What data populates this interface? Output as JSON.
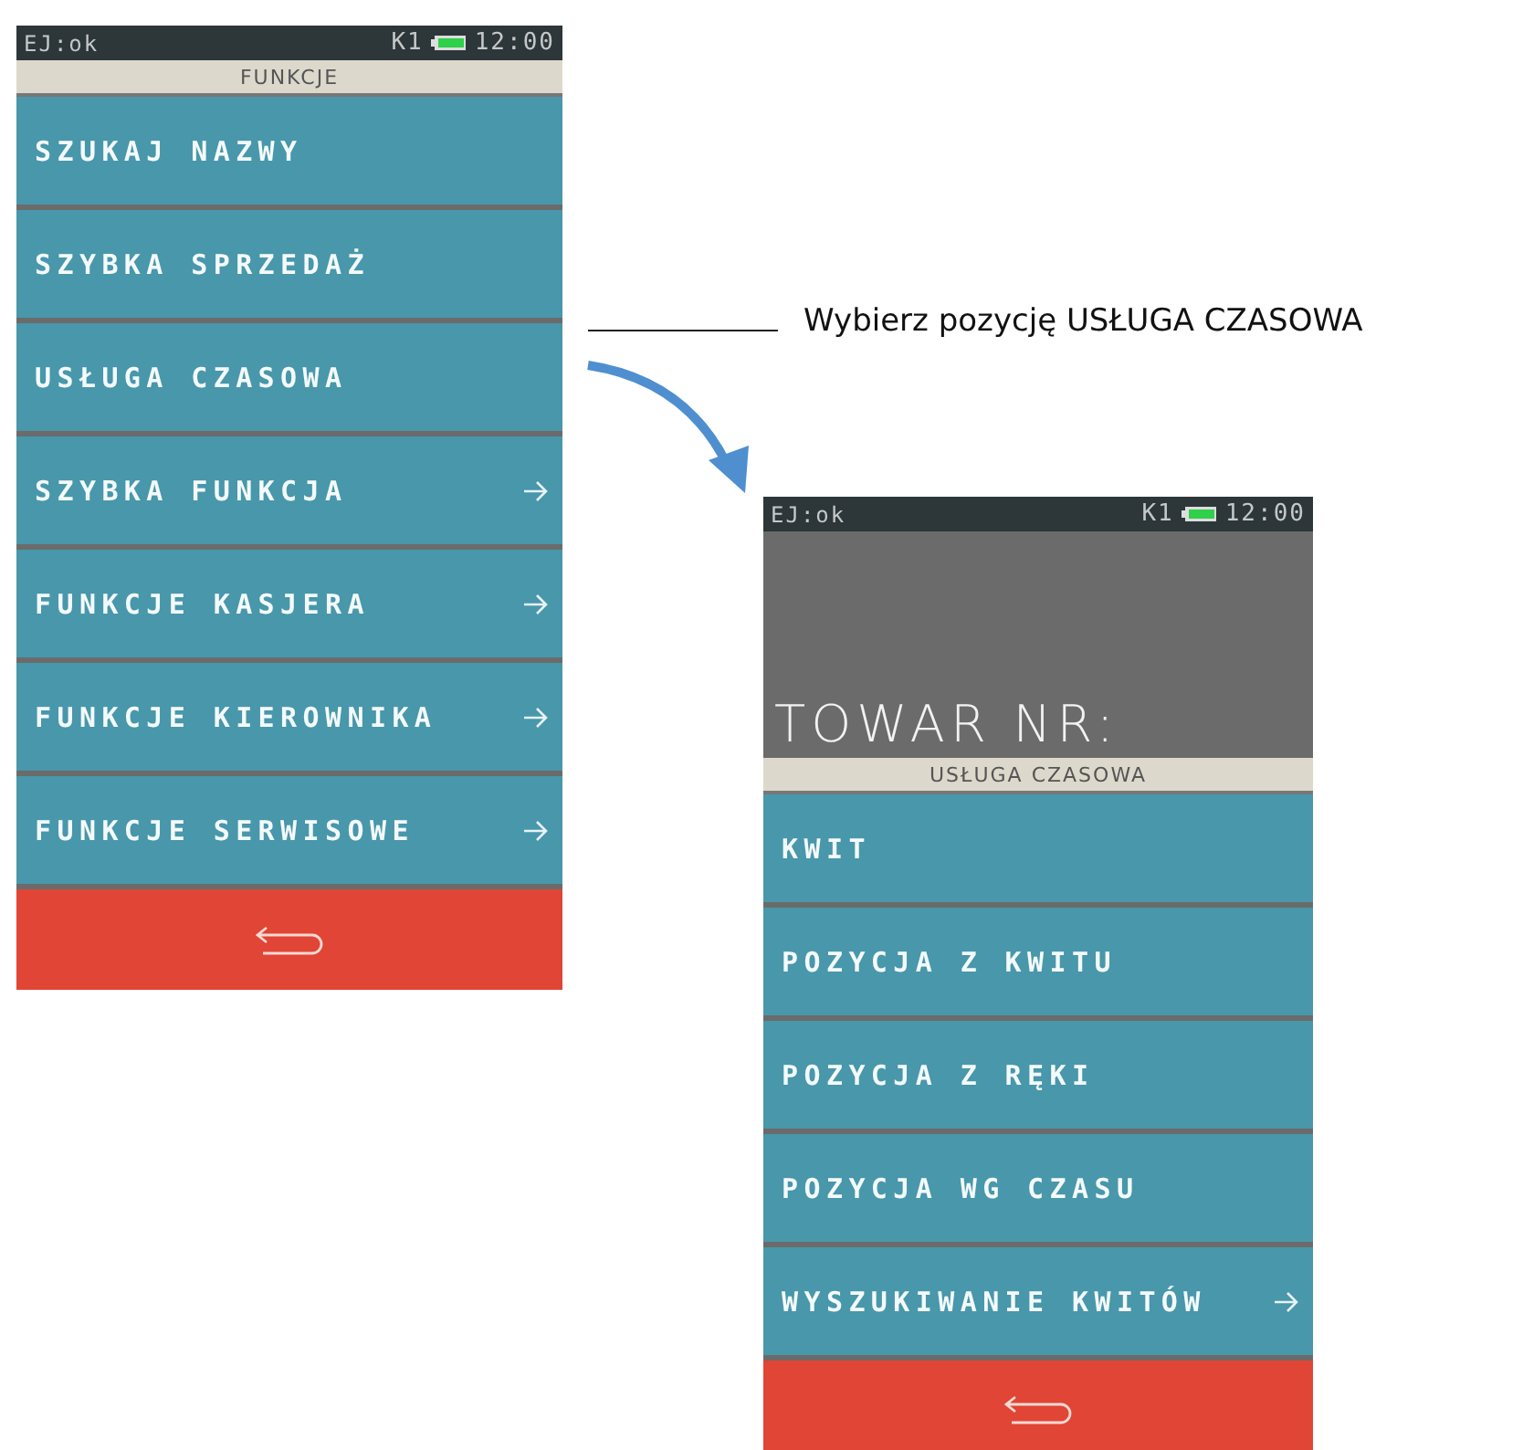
{
  "screens": [
    {
      "status": {
        "left": "EJ:ok",
        "channel": "K1",
        "time": "12:00"
      },
      "title": "FUNKCJE",
      "items": [
        {
          "label": "SZUKAJ NAZWY",
          "submenu": false
        },
        {
          "label": "SZYBKA SPRZEDAŻ",
          "submenu": false
        },
        {
          "label": "USŁUGA CZASOWA",
          "submenu": false
        },
        {
          "label": "SZYBKA FUNKCJA",
          "submenu": true
        },
        {
          "label": "FUNKCJE KASJERA",
          "submenu": true
        },
        {
          "label": "FUNKCJE KIEROWNIKA",
          "submenu": true
        },
        {
          "label": "FUNKCJE SERWISOWE",
          "submenu": true
        }
      ]
    },
    {
      "status": {
        "left": "EJ:ok",
        "channel": "K1",
        "time": "12:00"
      },
      "display": "TOWAR NR:",
      "title": "USŁUGA CZASOWA",
      "items": [
        {
          "label": "KWIT",
          "submenu": false
        },
        {
          "label": "POZYCJA Z KWITU",
          "submenu": false
        },
        {
          "label": "POZYCJA Z RĘKI",
          "submenu": false
        },
        {
          "label": "POZYCJA WG CZASU",
          "submenu": false
        },
        {
          "label": "WYSZUKIWANIE KWITÓW",
          "submenu": true
        }
      ]
    }
  ],
  "callout": "Wybierz pozycję USŁUGA CZASOWA"
}
